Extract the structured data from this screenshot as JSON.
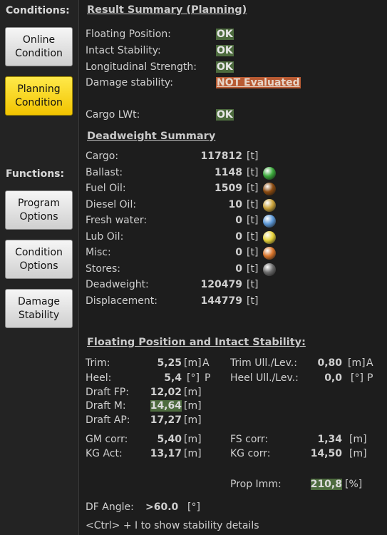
{
  "sidebar": {
    "conditions_label": "Conditions:",
    "functions_label": "Functions:",
    "buttons": {
      "online": "Online\nCondition",
      "planning": "Planning\nCondition",
      "program": "Program\nOptions",
      "condition": "Condition\nOptions",
      "damage": "Damage\nStability"
    }
  },
  "result": {
    "title": "Result Summary (Planning)",
    "rows": [
      {
        "label": "Floating Position:",
        "status": "OK"
      },
      {
        "label": "Intact Stability:",
        "status": "OK"
      },
      {
        "label": "Longitudinal Strength:",
        "status": "OK"
      },
      {
        "label": "Damage stability:",
        "status": "NOT Evaluated"
      },
      {
        "label": "Cargo LWt:",
        "status": "OK"
      }
    ]
  },
  "deadweight": {
    "title": "Deadweight Summary",
    "rows": [
      {
        "label": "Cargo:",
        "value": "117812",
        "unit": "[t]"
      },
      {
        "label": "Ballast:",
        "value": "1148",
        "unit": "[t]",
        "color": "#3aa83a"
      },
      {
        "label": "Fuel Oil:",
        "value": "1509",
        "unit": "[t]",
        "color": "#8a4a10"
      },
      {
        "label": "Diesel Oil:",
        "value": "10",
        "unit": "[t]",
        "color": "#c9a23a"
      },
      {
        "label": "Fresh water:",
        "value": "0",
        "unit": "[t]",
        "color": "#5b97d6"
      },
      {
        "label": "Lub Oil:",
        "value": "0",
        "unit": "[t]",
        "color": "#e6d23a"
      },
      {
        "label": "Misc:",
        "value": "0",
        "unit": "[t]",
        "color": "#d8742a"
      },
      {
        "label": "Stores:",
        "value": "0",
        "unit": "[t]",
        "color": "#6a6a6a"
      },
      {
        "label": "Deadweight:",
        "value": "120479",
        "unit": "[t]"
      },
      {
        "label": "Displacement:",
        "value": "144779",
        "unit": "[t]"
      }
    ]
  },
  "stability": {
    "title": "Floating Position and Intact Stability:",
    "trim": {
      "label": "Trim:",
      "value": "5,25",
      "unit": "[m]",
      "dir": "A"
    },
    "heel": {
      "label": "Heel:",
      "value": "5,4",
      "unit": "[°]",
      "dir": "P"
    },
    "trim_ull": {
      "label": "Trim Ull./Lev.:",
      "value": "0,80",
      "unit": "[m]",
      "dir": "A"
    },
    "heel_ull": {
      "label": "Heel Ull./Lev.:",
      "value": "0,0",
      "unit": "[°]",
      "dir": "P"
    },
    "draft_fp": {
      "label": "Draft FP:",
      "value": "12,02",
      "unit": "[m]"
    },
    "draft_m": {
      "label": "Draft M:",
      "value": "14,64",
      "unit": "[m]"
    },
    "draft_ap": {
      "label": "Draft AP:",
      "value": "17,27",
      "unit": "[m]"
    },
    "gm_corr": {
      "label": "GM corr:",
      "value": "5,40",
      "unit": "[m]"
    },
    "kg_act": {
      "label": "KG Act:",
      "value": "13,17",
      "unit": "[m]"
    },
    "fs_corr": {
      "label": "FS corr:",
      "value": "1,34",
      "unit": "[m]"
    },
    "kg_corr": {
      "label": "KG corr:",
      "value": "14,50",
      "unit": "[m]"
    },
    "prop_imm": {
      "label": "Prop Imm:",
      "value": "210,8",
      "unit": "[%]"
    },
    "df_angle": {
      "label": "DF Angle:",
      "value": ">60.0",
      "unit": "[°]"
    },
    "hint": "<Ctrl> + I to show stability details"
  }
}
